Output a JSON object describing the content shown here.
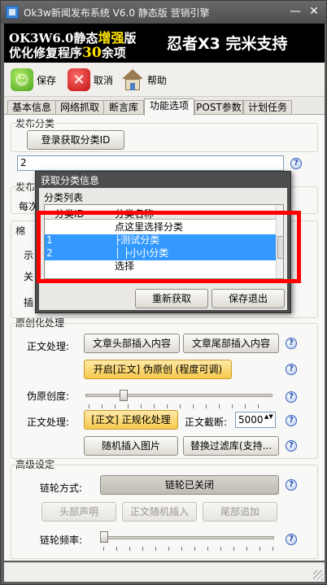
{
  "window": {
    "title": "Ok3w新闻发布系统 V6.0 静态版  营销引擎",
    "min_glyph": "—",
    "close_glyph": "✕"
  },
  "banner": {
    "line1_a": "OK3W6.0静态",
    "line1_b": "增强",
    "line1_c": "版",
    "line2_a": "优化修复程序",
    "line2_b": "30",
    "line2_c": "余项",
    "right_text": "忍者X3 完米支持"
  },
  "toolbar": {
    "save_label": "保存",
    "cancel_label": "取消",
    "help_label": "帮助"
  },
  "tabs": [
    "基本信息",
    "网络抓取",
    "断言库",
    "功能选项",
    "POST参数",
    "计划任务"
  ],
  "active_tab": "功能选项",
  "panel": {
    "publish_category_label": "发布分类",
    "login_fetch_button": "登录获取分类ID",
    "category_id_value": "2",
    "publish_label_partial": "发布",
    "each_label_partial": "每次",
    "left_partial_1": "棉",
    "left_partial_2": "示",
    "left_partial_3": "关",
    "left_partial_4": "插",
    "original_label": "原创化处理",
    "body_process_label": "正文处理:",
    "article_head_insert": "文章头部插入内容",
    "article_tail_insert": "文章尾部插入内容",
    "enable_pseudo_original": "开启[正文] 伪原创 (程度可调)",
    "pseudo_degree_label": "伪原创度:",
    "body_process_label2": "正文处理:",
    "normalize_button": "[正文] 正规化处理",
    "body_cut_label": "正文截断:",
    "body_cut_value": "5000",
    "random_image_button": "随机插入图片",
    "replace_filter_button": "替换过滤库(支持...",
    "advanced_label": "高级设定",
    "link_wheel_label": "链轮方式:",
    "link_wheel_status": "链轮已关闭",
    "header_statement": "头部声明",
    "body_random_insert": "正文随机插入",
    "tail_append": "尾部追加",
    "link_frequency_label": "链轮频率:",
    "help_glyph": "?",
    "spin_glyph": "▲▼"
  },
  "dialog": {
    "title": "获取分类信息",
    "group_label": "分类列表",
    "col_id": "分类ID",
    "col_name": "分类名称",
    "rows": [
      {
        "id": "",
        "name": "点这里选择分类",
        "selected": false
      },
      {
        "id": "1",
        "name": "├测试分类",
        "selected": true
      },
      {
        "id": "2",
        "name": "│  ├小小分类",
        "selected": true
      },
      {
        "id": "",
        "name": "选择",
        "selected": false
      }
    ],
    "refetch_button": "重新获取",
    "save_exit_button": "保存退出"
  },
  "colors": {
    "highlight_red": "#ff0000",
    "selection_blue": "#3399ff",
    "banner_yellow": "#ffe200"
  }
}
